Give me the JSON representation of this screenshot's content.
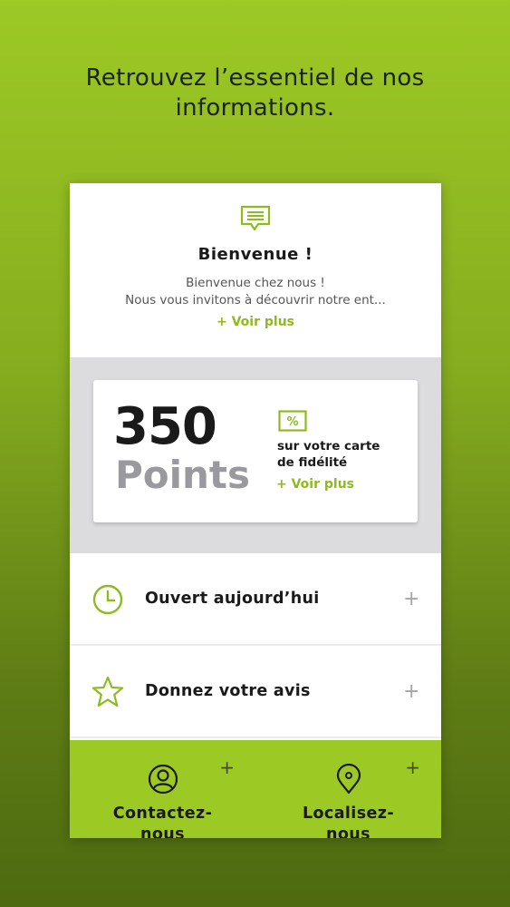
{
  "headline": {
    "line1": "Retrouvez l’essentiel de nos",
    "line2": "informations."
  },
  "welcome": {
    "icon": "message-icon",
    "title": "Bienvenue !",
    "line1": "Bienvenue chez nous !",
    "line2": "Nous vous invitons à découvrir notre ent...",
    "more_label": "+ Voir plus"
  },
  "loyalty": {
    "points_value": "350",
    "points_label": "Points",
    "icon": "percent-icon",
    "text_line1": "sur votre carte",
    "text_line2": "de fidélité",
    "more_label": "+ Voir plus"
  },
  "rows": [
    {
      "icon": "clock-icon",
      "label": "Ouvert aujourd’hui",
      "action": "+"
    },
    {
      "icon": "star-icon",
      "label": "Donnez votre avis",
      "action": "+"
    }
  ],
  "tiles": [
    {
      "icon": "user-icon",
      "line1": "Contactez-",
      "line2": "nous",
      "action": "+"
    },
    {
      "icon": "map-pin-icon",
      "line1": "Localisez-",
      "line2": "nous",
      "action": "+"
    }
  ],
  "colors": {
    "accent": "#8dbb1f",
    "tile_background": "#9dc925",
    "loyalty_background": "#dcdcde"
  }
}
